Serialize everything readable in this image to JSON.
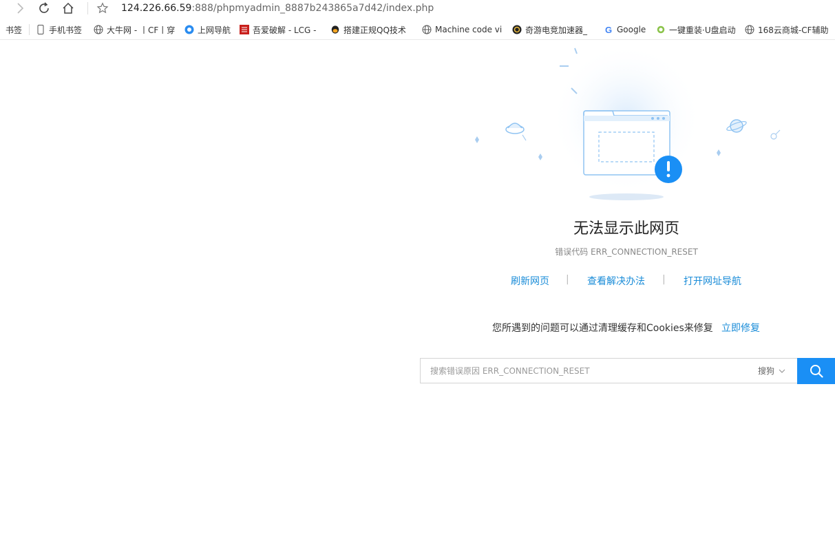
{
  "browser": {
    "url_host": "124.226.66.59",
    "url_path": ":888/phpmyadmin_8887b243865a7d42/index.php"
  },
  "bookmarks": {
    "items": [
      {
        "label": "书签",
        "icon": "none"
      },
      {
        "label": "手机书签",
        "icon": "phone-icon"
      },
      {
        "label": "大牛网 - 丨CF丨穿",
        "icon": "globe-icon"
      },
      {
        "label": "上网导航",
        "icon": "navigation-icon"
      },
      {
        "label": "吾爱破解 - LCG -",
        "icon": "52pojie-icon"
      },
      {
        "label": "搭建正规QQ技术",
        "icon": "qq-icon"
      },
      {
        "label": "Machine code vi",
        "icon": "globe-icon"
      },
      {
        "label": "奇游电竞加速器_",
        "icon": "qiyou-icon"
      },
      {
        "label": "Google",
        "icon": "google-icon"
      },
      {
        "label": "一键重装·U盘启动",
        "icon": "reinstall-icon"
      },
      {
        "label": "168云商城-CF辅助",
        "icon": "globe-icon"
      }
    ]
  },
  "error": {
    "title": "无法显示此网页",
    "code_label": "错误代码 ERR_CONNECTION_RESET",
    "links": [
      "刷新网页",
      "查看解决办法",
      "打开网址导航"
    ],
    "separator": "|",
    "fix_text": "您所遇到的问题可以通过清理缓存和Cookies来修复",
    "fix_link": "立即修复"
  },
  "search": {
    "placeholder": "搜索错误原因 ERR_CONNECTION_RESET",
    "value": "",
    "engine": "搜狗"
  },
  "colors": {
    "accent": "#1a8cd8",
    "search_button": "#1a8ff5",
    "alert": "#1a8ff5"
  }
}
